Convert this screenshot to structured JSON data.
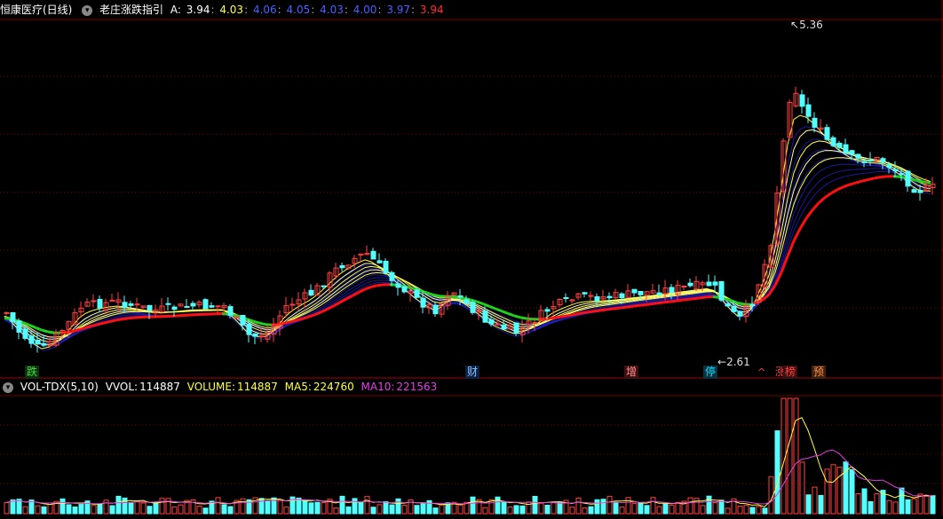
{
  "main_header": {
    "stock_name": "恒康医疗(日线)",
    "indicator_name": "老庄涨跌指引",
    "a_label": "A:",
    "a_values": [
      "3.94",
      "4.03",
      "4.06",
      "4.05",
      "4.03",
      "4.00",
      "3.97",
      "3.94"
    ],
    "separator": ":"
  },
  "annotations": {
    "high_label": "5.36",
    "low_label": "2.61",
    "signals": [
      {
        "text": "跌",
        "color": "#40e040",
        "bg": "#103010"
      },
      {
        "text": "财",
        "color": "#80c0ff",
        "bg": "#102040"
      },
      {
        "text": "增",
        "color": "#ff9090",
        "bg": "#401010"
      },
      {
        "text": "停",
        "color": "#00e0ff",
        "bg": "#103040"
      },
      {
        "text": "涨",
        "color": "#ff4040",
        "bg": ""
      },
      {
        "text": "榜",
        "color": "#ff4040",
        "bg": "#401010"
      },
      {
        "text": "预",
        "color": "#ff9040",
        "bg": "#402010"
      }
    ],
    "double_caret": "^"
  },
  "volume_header": {
    "indicator": "VOL-TDX(5,10)",
    "vvol_label": "VVOL:",
    "vvol_value": "114887",
    "volume_label": "VOLUME:",
    "volume_value": "114887",
    "ma5_label": "MA5:",
    "ma5_value": "224760",
    "ma10_label": "MA10:",
    "ma10_value": "221563"
  },
  "colors": {
    "up": "#ff4040",
    "down": "#54ffff",
    "ma5": "#ffff40",
    "ma10": "#e040e0",
    "red_line": "#ff1010",
    "green_line": "#20d020",
    "blue_band": "#2020c0",
    "grid": "#7a0000"
  }
}
